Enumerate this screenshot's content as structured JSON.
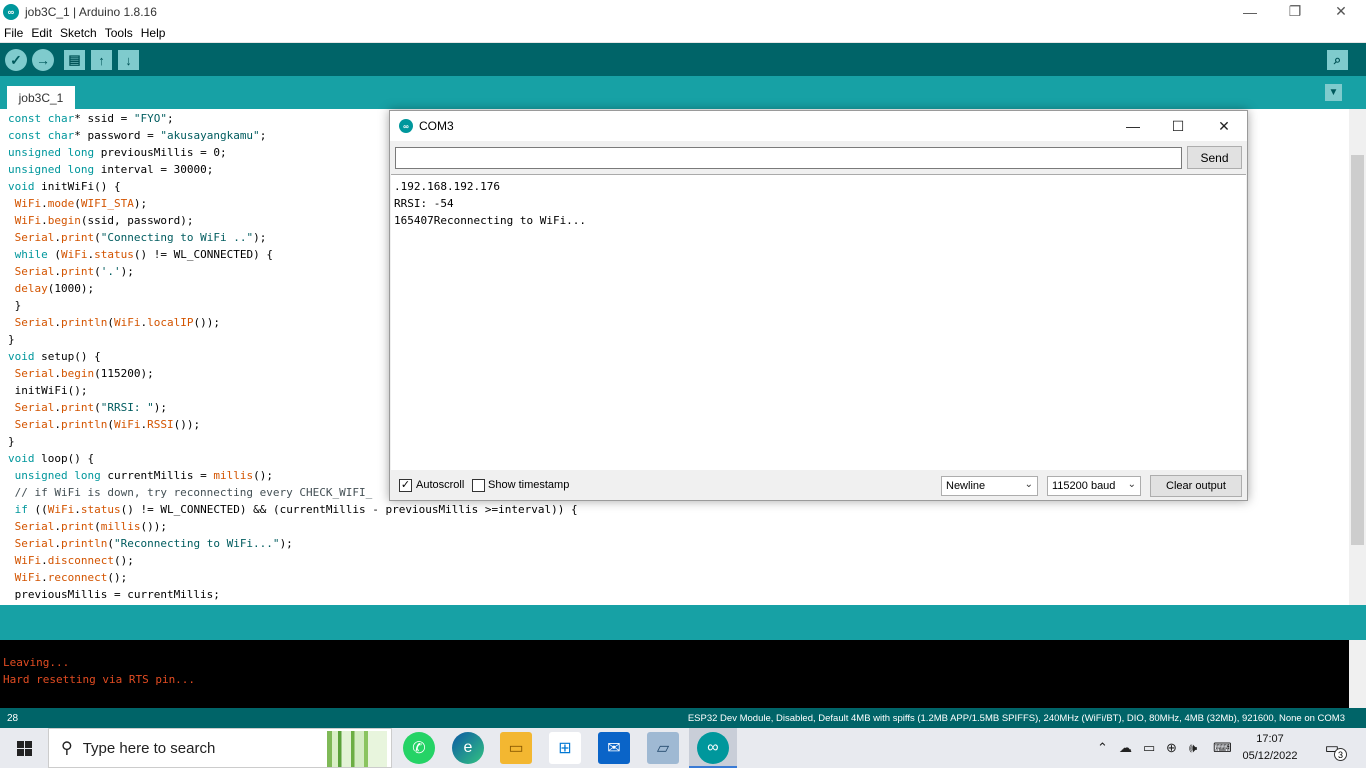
{
  "window": {
    "title": "job3C_1 | Arduino 1.8.16",
    "app_icon": "∞",
    "minimize": "—",
    "restore": "❐",
    "close": "✕"
  },
  "menu": [
    "File",
    "Edit",
    "Sketch",
    "Tools",
    "Help"
  ],
  "toolbar": {
    "verify_icon": "✓",
    "upload_icon": "→",
    "new_icon": "▤",
    "open_icon": "↑",
    "save_icon": "↓",
    "serial_monitor_icon": "⌕"
  },
  "tabs": {
    "active": "job3C_1",
    "menu_icon": "▼"
  },
  "editor_lines": [
    "const char* ssid = \"FYO\";",
    "const char* password = \"akusayangkamu\";",
    "unsigned long previousMillis = 0;",
    "unsigned long interval = 30000;",
    "void initWiFi() {",
    " WiFi.mode(WIFI_STA);",
    " WiFi.begin(ssid, password);",
    " Serial.print(\"Connecting to WiFi ..\");",
    " while (WiFi.status() != WL_CONNECTED) {",
    " Serial.print('.');",
    " delay(1000);",
    " }",
    " Serial.println(WiFi.localIP());",
    "}",
    "void setup() {",
    " Serial.begin(115200);",
    " initWiFi();",
    " Serial.print(\"RRSI: \");",
    " Serial.println(WiFi.RSSI());",
    "}",
    "void loop() {",
    " unsigned long currentMillis = millis();",
    " // if WiFi is down, try reconnecting every CHECK_WIFI_",
    " if ((WiFi.status() != WL_CONNECTED) && (currentMillis - previousMillis >=interval)) {",
    " Serial.print(millis());",
    " Serial.println(\"Reconnecting to WiFi...\");",
    " WiFi.disconnect();",
    " WiFi.reconnect();",
    " previousMillis = currentMillis;"
  ],
  "console_lines": [
    "Leaving...",
    "Hard resetting via RTS pin..."
  ],
  "footer": {
    "line": "28",
    "board": "ESP32 Dev Module, Disabled, Default 4MB with spiffs (1.2MB APP/1.5MB SPIFFS), 240MHz (WiFi/BT), DIO, 80MHz, 4MB (32Mb), 921600, None on COM3"
  },
  "serial_monitor": {
    "title": "COM3",
    "input_value": "",
    "send_label": "Send",
    "output": ".192.168.192.176\nRRSI: -54\n165407Reconnecting to WiFi...",
    "autoscroll_label": "Autoscroll",
    "autoscroll_checked": "✓",
    "timestamp_label": "Show timestamp",
    "line_ending": "Newline",
    "baud": "115200 baud",
    "clear_label": "Clear output",
    "dropdown_icon": "⌄"
  },
  "taskbar": {
    "search_placeholder": "Type here to search",
    "apps": [
      "whatsapp-icon",
      "edge-icon",
      "file-explorer-icon",
      "store-icon",
      "mail-icon",
      "notepad-icon",
      "arduino-icon"
    ],
    "time": "17:07",
    "date": "05/12/2022",
    "notification_count": "3"
  }
}
